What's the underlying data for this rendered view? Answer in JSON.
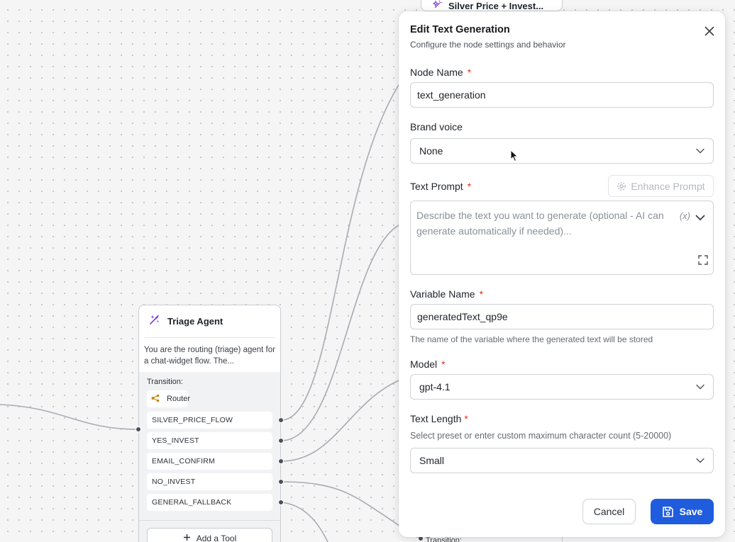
{
  "canvas": {
    "top_node_title": "Silver Price + Invest...",
    "bottom_peek": "Transition:",
    "node": {
      "title": "Triage Agent",
      "description": "You are the routing (triage) agent for a chat-widget flow. The...",
      "transition_label": "Transition:",
      "router_label": "Router",
      "routes": [
        "SILVER_PRICE_FLOW",
        "YES_INVEST",
        "EMAIL_CONFIRM",
        "NO_INVEST",
        "GENERAL_FALLBACK"
      ],
      "add_tool_label": "Add a Tool",
      "accent_color": "#7b3fe4",
      "router_color": "#c8870e"
    }
  },
  "panel": {
    "title": "Edit Text Generation",
    "subtitle": "Configure the node settings and behavior",
    "node_name": {
      "label": "Node Name",
      "value": "text_generation"
    },
    "brand_voice": {
      "label": "Brand voice",
      "value": "None"
    },
    "text_prompt": {
      "label": "Text Prompt",
      "enhance_label": "Enhance Prompt",
      "placeholder": "Describe the text you want to generate (optional - AI can generate automatically if needed)...",
      "variable_icon": "(x)"
    },
    "variable_name": {
      "label": "Variable Name",
      "value": "generatedText_qp9e",
      "hint": "The name of the variable where the generated text will be stored"
    },
    "model": {
      "label": "Model",
      "value": "gpt-4.1"
    },
    "text_length": {
      "label": "Text Length",
      "hint": "Select preset or enter custom maximum character count (5-20000)",
      "value": "Small"
    },
    "required_mark": "*",
    "cancel_label": "Cancel",
    "save_label": "Save",
    "primary_color": "#1f5cde"
  }
}
